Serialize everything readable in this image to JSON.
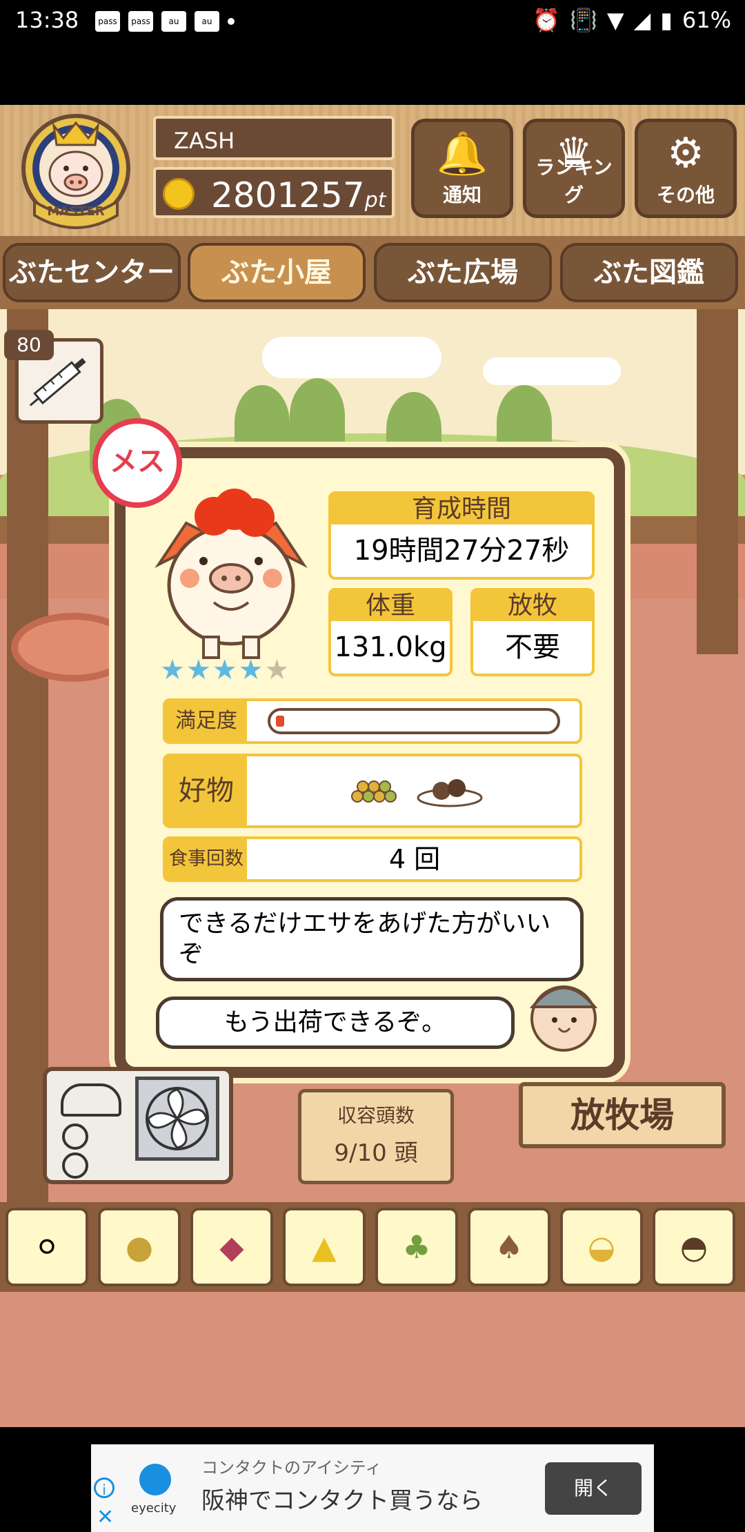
{
  "status_bar": {
    "time": "13:38",
    "notification_icons": [
      "pass",
      "pass",
      "au",
      "au"
    ],
    "battery": "61%"
  },
  "header": {
    "badge_label": "MASTER",
    "username": "ZASH",
    "points": "2801257",
    "points_unit": "pt",
    "buttons": [
      {
        "label": "通知",
        "icon": "bell-icon"
      },
      {
        "label": "ランキング",
        "icon": "crown-icon"
      },
      {
        "label": "その他",
        "icon": "gear-icon"
      }
    ]
  },
  "nav": {
    "tabs": [
      {
        "label": "ぶたセンター",
        "active": false
      },
      {
        "label": "ぶた小屋",
        "active": true
      },
      {
        "label": "ぶた広場",
        "active": false
      },
      {
        "label": "ぶた図鑑",
        "active": false
      }
    ]
  },
  "syringe": {
    "count": "80"
  },
  "pig_card": {
    "gender_label": "メス",
    "rating": 4,
    "rating_max": 5,
    "growth_time_label": "育成時間",
    "growth_time_value": "19時間27分27秒",
    "weight_label": "体重",
    "weight_value": "131.0kg",
    "graze_label": "放牧",
    "graze_value": "不要",
    "satisfaction_label": "満足度",
    "satisfaction_level": 0.03,
    "favorite_label": "好物",
    "favorites": [
      "grain-icon",
      "meatball-plate-icon"
    ],
    "meals_label": "食事回数",
    "meals_value": "4 回",
    "advice_text": "できるだけエサをあげた方がいいぞ",
    "ship_text": "もう出荷できるぞ。"
  },
  "pen": {
    "capacity_label": "収容頭数",
    "capacity_value": "9/10 頭",
    "graze_sign": "放牧場"
  },
  "food_tray": [
    "white-beans-icon",
    "mixed-grain-icon",
    "sweet-potato-icon",
    "corn-icon",
    "vegetable-icon",
    "acorn-icon",
    "grain-plate-icon",
    "meatball-plate-icon"
  ],
  "ad": {
    "brand": "eyecity",
    "line1": "コンタクトのアイシティ",
    "line2": "阪神でコンタクト買うなら",
    "button": "開く"
  },
  "colors": {
    "wood_dark": "#6b4a35",
    "accent_yellow": "#f3c53a",
    "female_red": "#e63d4f",
    "star_blue": "#5fb8e0"
  }
}
